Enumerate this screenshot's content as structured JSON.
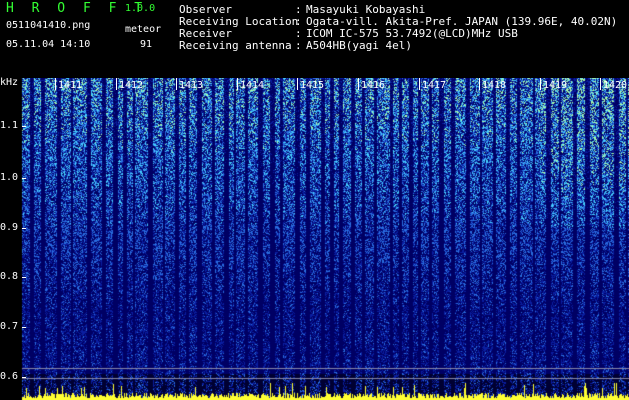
{
  "header": {
    "app_title": "H R O F F T",
    "version": "1.0.0",
    "file_name": "0511041410.png",
    "mode": "meteor",
    "datetime": "05.11.04 14:10",
    "count": "91"
  },
  "meta": [
    {
      "key": "Observer",
      "value": "Masayuki Kobayashi"
    },
    {
      "key": "Receiving Location",
      "value": "Ogata-vill. Akita-Pref. JAPAN (139.96E, 40.02N)"
    },
    {
      "key": "Receiver",
      "value": "ICOM IC-575 53.7492(@LCD)MHz USB"
    },
    {
      "key": "Receiving antenna",
      "value": "A504HB(yagi 4el)"
    }
  ],
  "colon": ":",
  "spectrogram": {
    "y_unit": "kHz",
    "y_ticks": [
      "1.1",
      "1.0",
      "0.9",
      "0.8",
      "0.7",
      "0.6"
    ],
    "minutes": [
      "1411",
      "1412",
      "1413",
      "1414",
      "1415",
      "1416",
      "1417",
      "1418",
      "1419",
      "1420"
    ],
    "colors": {
      "background": "#000066",
      "low": "#0a1ea0",
      "mid": "#2a6ee0",
      "high": "#46d2ff",
      "peak": "#aaffaa",
      "baseline": "#ffff33"
    }
  }
}
